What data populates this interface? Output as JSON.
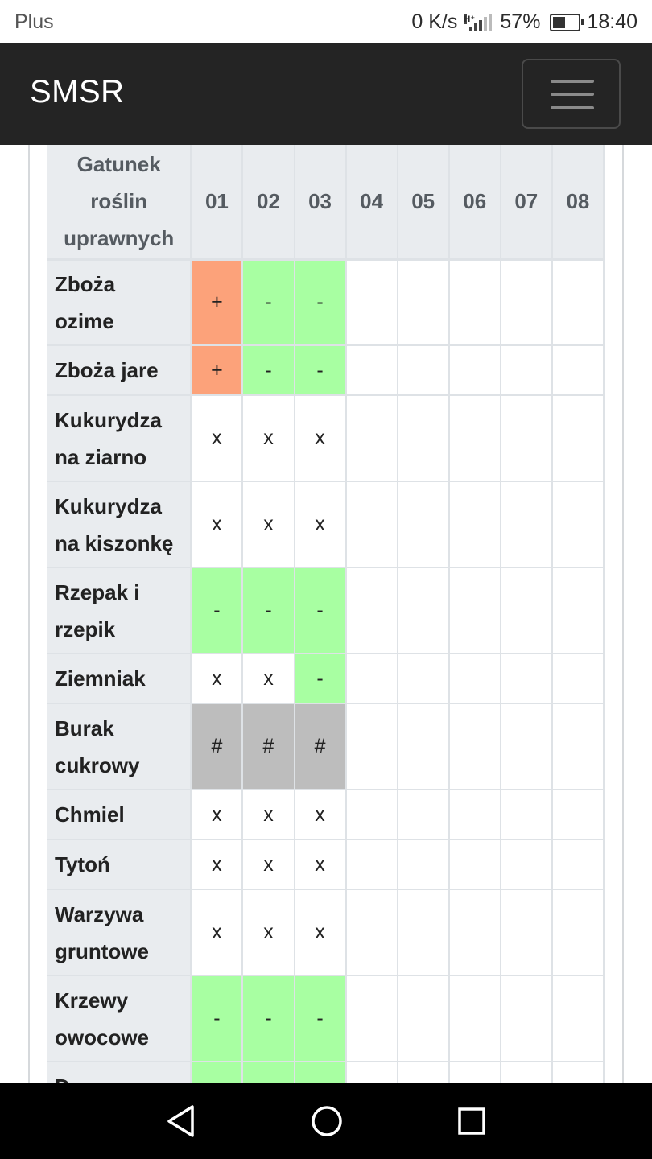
{
  "status_bar": {
    "carrier": "Plus",
    "speed": "0 K/s",
    "network_type": "H⁺",
    "battery": "57%",
    "battery_level": 0.57,
    "time": "18:40"
  },
  "navbar": {
    "brand": "SMSR",
    "menu_icon": "hamburger-menu-icon"
  },
  "table": {
    "corner_header": "Gatunek\nroślin\nuprawnych",
    "columns": [
      "01",
      "02",
      "03",
      "04",
      "05",
      "06",
      "07",
      "08"
    ],
    "rows": [
      {
        "name": "Zboża\nozime",
        "cells": [
          "+",
          "-",
          "-"
        ]
      },
      {
        "name": "Zboża jare",
        "cells": [
          "+",
          "-",
          "-"
        ]
      },
      {
        "name": "Kukurydza\nna ziarno",
        "cells": [
          "x",
          "x",
          "x"
        ]
      },
      {
        "name": "Kukurydza\nna kiszonkę",
        "cells": [
          "x",
          "x",
          "x"
        ]
      },
      {
        "name": "Rzepak i\nrzepik",
        "cells": [
          "-",
          "-",
          "-"
        ]
      },
      {
        "name": "Ziemniak",
        "cells": [
          "x",
          "x",
          "-"
        ]
      },
      {
        "name": "Burak\ncukrowy",
        "cells": [
          "#",
          "#",
          "#"
        ]
      },
      {
        "name": "Chmiel",
        "cells": [
          "x",
          "x",
          "x"
        ]
      },
      {
        "name": "Tytoń",
        "cells": [
          "x",
          "x",
          "x"
        ]
      },
      {
        "name": "Warzywa\ngruntowe",
        "cells": [
          "x",
          "x",
          "x"
        ]
      },
      {
        "name": "Krzewy\nowocowe",
        "cells": [
          "-",
          "-",
          "-"
        ]
      },
      {
        "name": "Drzewa\nowocowe",
        "cells": [
          "-",
          "-",
          "-"
        ]
      }
    ]
  },
  "colors": {
    "plus": "#fca27a",
    "minus": "#a8ffa2",
    "hash": "#bdbdbd",
    "header_bg": "#e9ecef",
    "navbar_bg": "#242424"
  },
  "system_nav": {
    "back": "back-triangle-icon",
    "home": "home-circle-icon",
    "recents": "recents-square-icon"
  }
}
